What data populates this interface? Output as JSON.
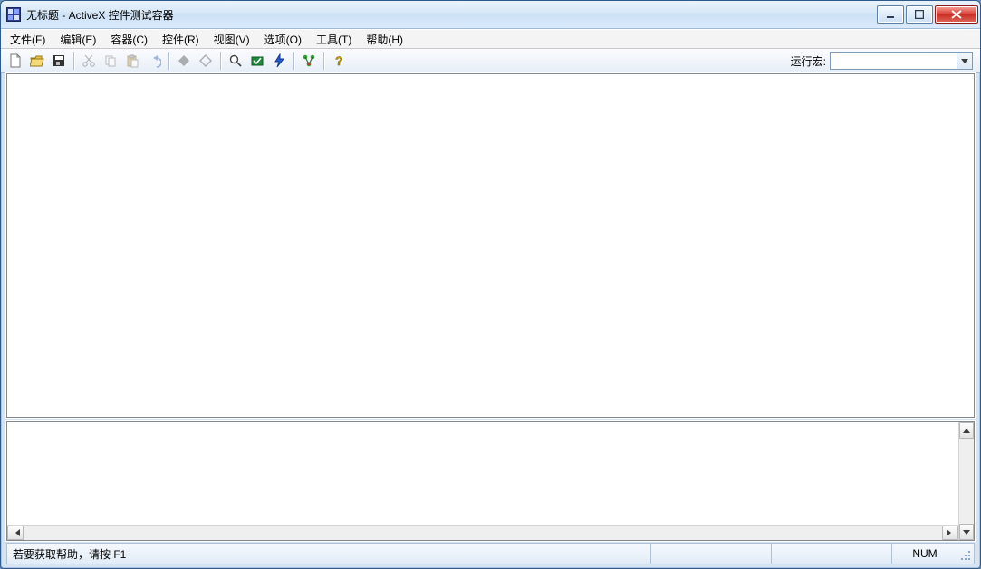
{
  "title": "无标题 - ActiveX 控件测试容器",
  "menus": {
    "file": "文件(F)",
    "edit": "编辑(E)",
    "container": "容器(C)",
    "control": "控件(R)",
    "view": "视图(V)",
    "options": "选项(O)",
    "tools": "工具(T)",
    "help": "帮助(H)"
  },
  "toolbar": {
    "run_macro_label": "运行宏:",
    "run_macro_value": ""
  },
  "status": {
    "message": "若要获取帮助，请按 F1",
    "num": "NUM"
  }
}
